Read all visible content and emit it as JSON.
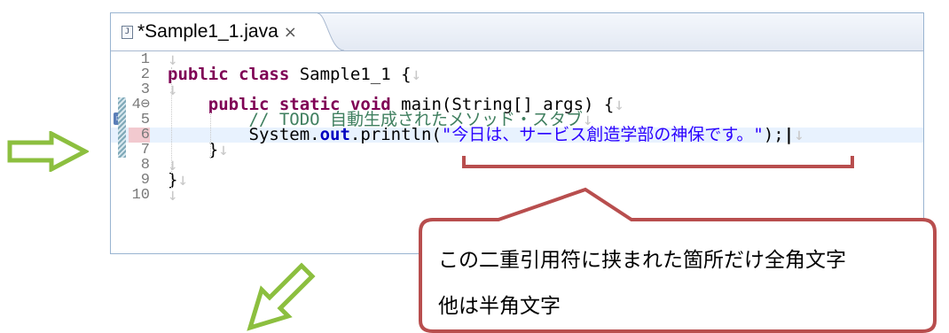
{
  "editor": {
    "tab": {
      "file_icon_glyph": "J",
      "title": "*Sample1_1.java",
      "close_glyph": "×"
    },
    "eol_glyph": "↓",
    "lines": [
      {
        "number": "1",
        "tokens": []
      },
      {
        "number": "2",
        "tokens": [
          {
            "t": "public",
            "c": "kw"
          },
          {
            "t": " "
          },
          {
            "t": "class",
            "c": "kw"
          },
          {
            "t": " Sample1_1 {"
          }
        ]
      },
      {
        "number": "3",
        "tokens": []
      },
      {
        "number": "4⊖",
        "marker": "",
        "tokens": [
          {
            "t": "    "
          },
          {
            "t": "public",
            "c": "kw"
          },
          {
            "t": " "
          },
          {
            "t": "static",
            "c": "kw"
          },
          {
            "t": " "
          },
          {
            "t": "void",
            "c": "kw"
          },
          {
            "t": " main(String[] args) {"
          }
        ]
      },
      {
        "number": "5",
        "marker": "task",
        "tokens": [
          {
            "t": "        "
          },
          {
            "t": "// TODO 自動生成されたメソッド・スタブ",
            "c": "cm"
          }
        ]
      },
      {
        "number": "6",
        "highlight": true,
        "current": true,
        "tokens": [
          {
            "t": "        System."
          },
          {
            "t": "out",
            "c": "fld"
          },
          {
            "t": ".println("
          },
          {
            "t": "\"今日は、サービス創造学部の神保です。\"",
            "c": "str"
          },
          {
            "t": ");"
          },
          {
            "t": "|",
            "c": "cursor-caret"
          }
        ]
      },
      {
        "number": "7",
        "tokens": [
          {
            "t": "    }"
          }
        ]
      },
      {
        "number": "8",
        "tokens": []
      },
      {
        "number": "9",
        "tokens": [
          {
            "t": "}"
          }
        ]
      },
      {
        "number": "10",
        "tokens": []
      }
    ]
  },
  "annotation": {
    "line1": "この二重引用符に挟まれた箇所だけ全角文字",
    "line2": "他は半角文字",
    "colors": {
      "callout_border": "#b84e4e",
      "arrow_fill": "#ffffff",
      "arrow_stroke": "#8cbf3f"
    }
  },
  "arrows": [
    {
      "name": "right-arrow",
      "direction": "right"
    },
    {
      "name": "down-left-arrow",
      "direction": "down-left"
    }
  ]
}
